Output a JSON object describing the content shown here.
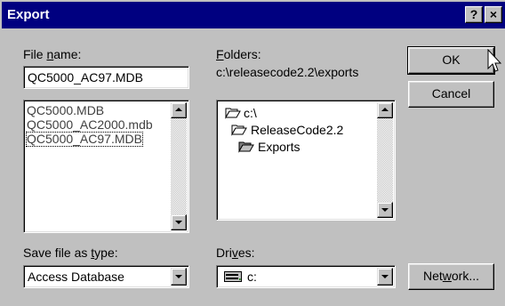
{
  "title": "Export",
  "title_buttons": {
    "help": "?",
    "close": "×"
  },
  "file_name": {
    "label_pre": "File ",
    "label_ul": "n",
    "label_post": "ame:",
    "value": "QC5000_AC97.MDB",
    "items": [
      "QC5000.MDB",
      "QC5000_AC2000.mdb",
      "QC5000_AC97.MDB"
    ]
  },
  "folders": {
    "label_pre": "",
    "label_ul": "F",
    "label_post": "olders:",
    "path": "c:\\releasecode2.2\\exports",
    "items": [
      "c:\\",
      "ReleaseCode2.2",
      "Exports"
    ]
  },
  "save_type": {
    "label_pre": "Save file as ",
    "label_ul": "t",
    "label_post": "ype:",
    "value": "Access Database"
  },
  "drives": {
    "label_pre": "Dri",
    "label_ul": "v",
    "label_post": "es:",
    "value": "c:"
  },
  "buttons": {
    "ok": "OK",
    "cancel": "Cancel",
    "network_pre": "Net",
    "network_ul": "w",
    "network_post": "ork..."
  },
  "colors": {
    "titlebar": "#000080",
    "face": "#c0c0c0"
  }
}
